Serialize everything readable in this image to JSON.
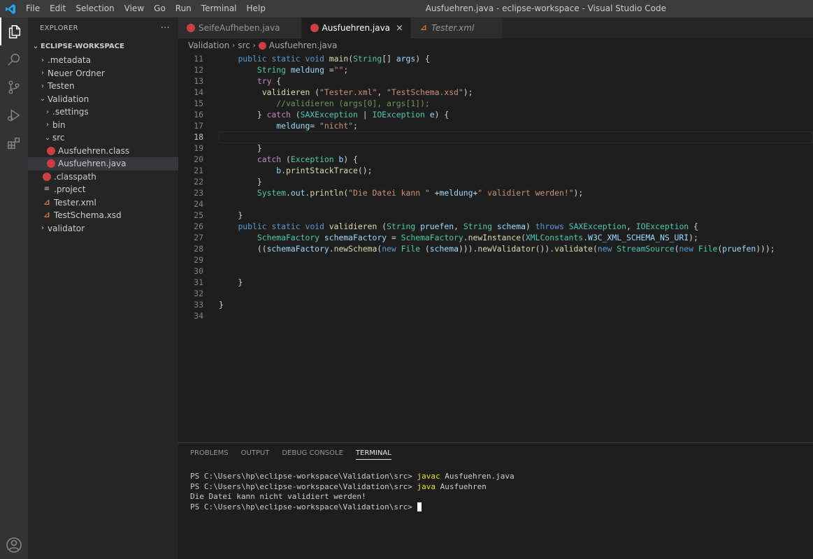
{
  "titlebar": {
    "menu": [
      "File",
      "Edit",
      "Selection",
      "View",
      "Go",
      "Run",
      "Terminal",
      "Help"
    ],
    "title": "Ausfuehren.java - eclipse-workspace - Visual Studio Code"
  },
  "activity_bar": {
    "items": [
      "explorer-icon",
      "search-icon",
      "source-control-icon",
      "run-debug-icon",
      "extensions-icon"
    ],
    "bottom": "account-icon"
  },
  "explorer": {
    "header": "EXPLORER",
    "more": "···",
    "section": "ECLIPSE-WORKSPACE",
    "items": [
      {
        "label": ".metadata",
        "type": "folder",
        "expanded": false
      },
      {
        "label": "Neuer Ordner",
        "type": "folder",
        "expanded": false
      },
      {
        "label": "Testen",
        "type": "folder",
        "expanded": false
      },
      {
        "label": "Validation",
        "type": "folder",
        "expanded": true
      },
      {
        "label": ".settings",
        "type": "folder",
        "expanded": false
      },
      {
        "label": "bin",
        "type": "folder",
        "expanded": false
      },
      {
        "label": "src",
        "type": "folder",
        "expanded": true
      },
      {
        "label": "Ausfuehren.class",
        "type": "java"
      },
      {
        "label": "Ausfuehren.java",
        "type": "java",
        "selected": true
      },
      {
        "label": ".classpath",
        "type": "java"
      },
      {
        "label": ".project",
        "type": "plain"
      },
      {
        "label": "Tester.xml",
        "type": "xml"
      },
      {
        "label": "TestSchema.xsd",
        "type": "xml"
      },
      {
        "label": "validator",
        "type": "folder",
        "expanded": false
      }
    ]
  },
  "tabs": [
    {
      "label": "SeifeAufheben.java",
      "icon": "java-icon",
      "active": false
    },
    {
      "label": "Ausfuehren.java",
      "icon": "java-icon",
      "active": true,
      "close": "×"
    },
    {
      "label": "Tester.xml",
      "icon": "rss-icon",
      "active": false
    }
  ],
  "breadcrumb": [
    "Validation",
    "src",
    "Ausfuehren.java"
  ],
  "editor": {
    "line_numbers": [
      "11",
      "12",
      "13",
      "14",
      "15",
      "16",
      "17",
      "18",
      "19",
      "20",
      "21",
      "22",
      "23",
      "24",
      "25",
      "26",
      "27",
      "28",
      "29",
      "30",
      "31",
      "32",
      "33",
      "34"
    ],
    "current_line": "18"
  },
  "panel": {
    "tabs": [
      "PROBLEMS",
      "OUTPUT",
      "DEBUG CONSOLE",
      "TERMINAL"
    ],
    "active_tab": "TERMINAL",
    "terminal": {
      "prompt": "PS C:\\Users\\hp\\eclipse-workspace\\Validation\\src>",
      "cmd1": "javac",
      "arg1": " Ausfuehren.java",
      "cmd2": "java",
      "arg2": " Ausfuehren",
      "output": "Die Datei kann nicht validiert werden!"
    }
  },
  "colors": {
    "titlebar": "#3c3c3c",
    "activity_bar": "#333333",
    "sidebar": "#252526",
    "editor": "#1e1e1e",
    "keyword": "#569cd6",
    "type": "#4ec9b0",
    "function": "#dcdcaa",
    "variable": "#9cdcfe",
    "string": "#ce9178",
    "comment": "#6a9955",
    "java_icon": "#cc3e44"
  }
}
